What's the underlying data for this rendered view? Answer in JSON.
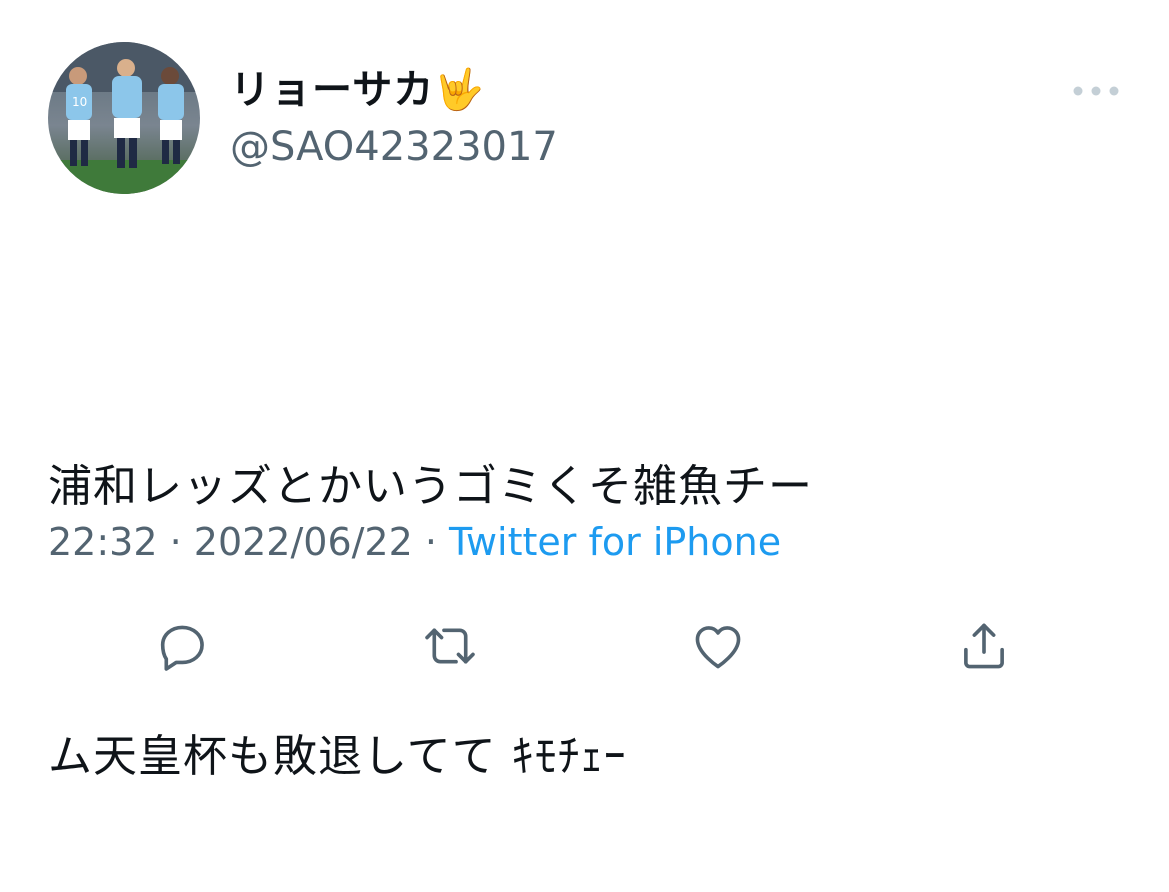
{
  "tweet": {
    "display_name": "リョーサカ🤟",
    "handle": "@SAO42323017",
    "text_line1": "浦和レッズとかいうゴミくそ雑魚チー",
    "text_line2": "ム天皇杯も敗退してて ｷﾓﾁｪｰ",
    "time": "22:32",
    "separator": " · ",
    "date": "2022/06/22",
    "source": "Twitter for iPhone"
  },
  "colors": {
    "text": "#0f1419",
    "secondary": "#536471",
    "link": "#1d9bf0",
    "icon": "#536471"
  },
  "icons": {
    "more": "more-horizontal-icon",
    "reply": "reply-icon",
    "retweet": "retweet-icon",
    "like": "heart-icon",
    "share": "share-icon"
  }
}
